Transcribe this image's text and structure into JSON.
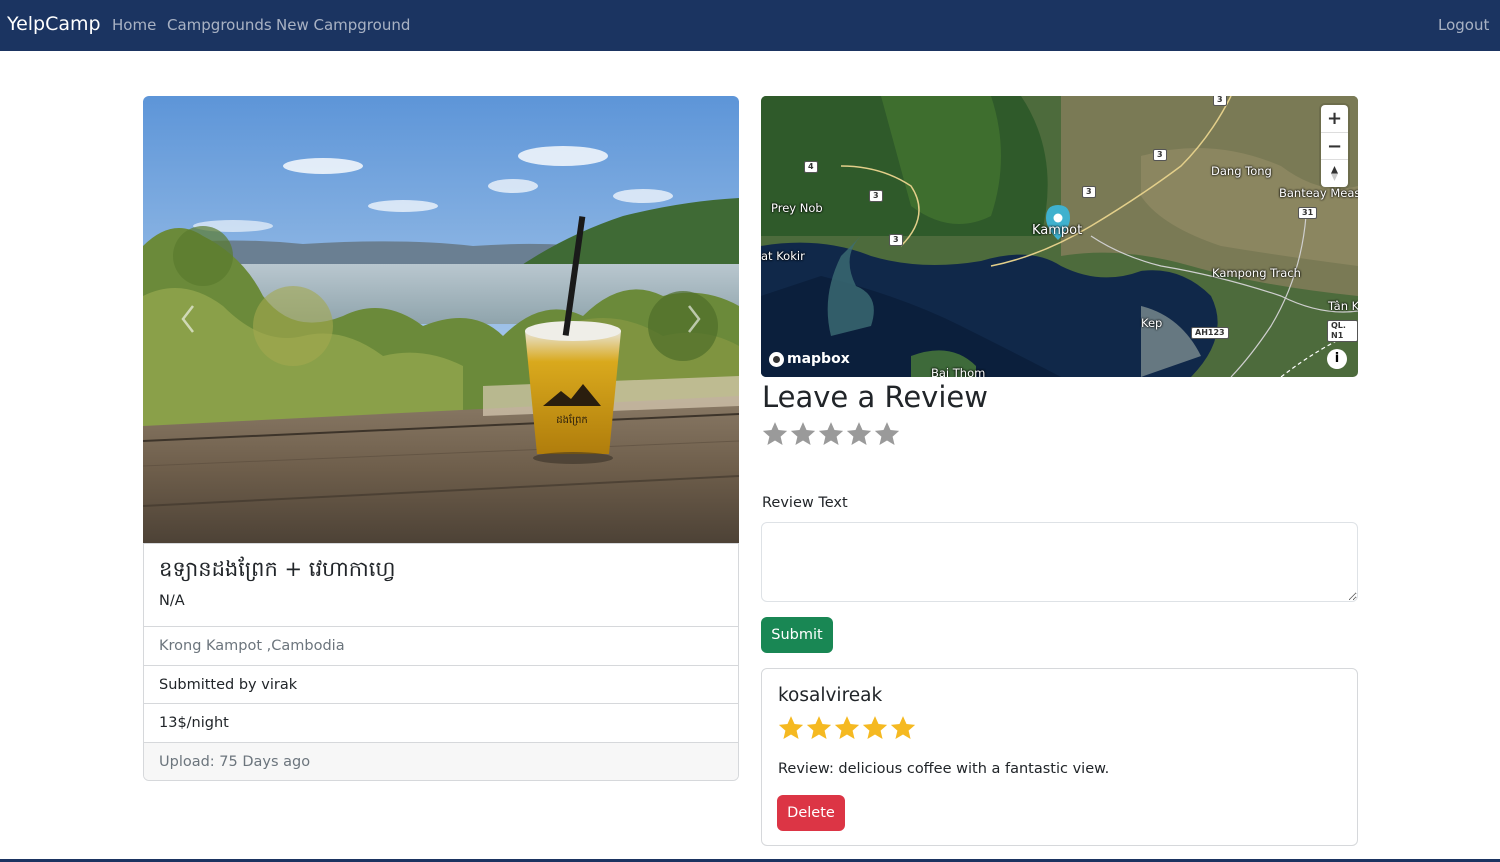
{
  "navbar": {
    "brand": "YelpCamp",
    "links": [
      "Home",
      "Campgrounds",
      "New Campground"
    ],
    "logout": "Logout",
    "bg_color": "#1b3461"
  },
  "campground": {
    "title": "ឧទ្យានដងព្រែក + វេហាកាហ្វេ",
    "description": "N/A",
    "location": "Krong Kampot ,Cambodia",
    "submitted_by": "Submitted by virak",
    "price": "13$/night",
    "upload": "Upload: 75 Days ago"
  },
  "photo": {
    "cup_logo_text": "ដងព្រែក"
  },
  "map": {
    "zoom_in": "+",
    "zoom_out": "−",
    "compass": "▲",
    "attribution_logo": "mapbox",
    "info_icon": "i",
    "labels": [
      "Dang Tong",
      "Banteay Meas",
      "Prey Nob",
      "Kampot",
      "Kampong Trach",
      "Kep",
      "Bai Thom",
      "at Kokir",
      "Tân K",
      "QL. N1"
    ],
    "shields": [
      "3",
      "4",
      "3",
      "3",
      "3",
      "3",
      "31",
      "AH123"
    ]
  },
  "review_form": {
    "heading": "Leave a Review",
    "rating_value": 0,
    "rating_max": 5,
    "text_label": "Review Text",
    "text_value": "",
    "submit_label": "Submit",
    "submit_color": "#198754"
  },
  "reviews": [
    {
      "author": "kosalvireak",
      "rating": 5,
      "text": "Review: delicious coffee with a fantastic view.",
      "delete_label": "Delete",
      "delete_color": "#dc3545"
    }
  ]
}
